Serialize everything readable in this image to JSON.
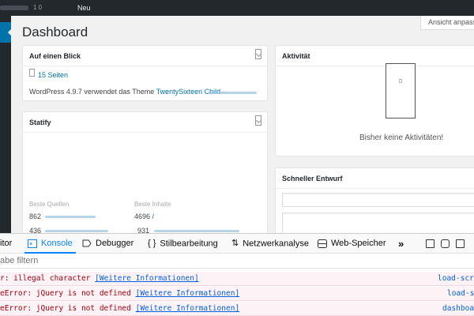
{
  "adminbar": {
    "counter": "1 0",
    "new_label": "Neu"
  },
  "header": {
    "title": "Dashboard",
    "screen_options": "Ansicht anpassen"
  },
  "at_a_glance": {
    "title": "Auf einen Blick",
    "pages": "15 Seiten",
    "wp_text": "WordPress 4.9.7 verwendet das Theme",
    "theme_link": "TwentySixteen Child"
  },
  "statify": {
    "title": "Statify",
    "col1_header": "Beste Quellen",
    "col2_header": "Beste Inhalte",
    "rows": [
      {
        "count1": "862",
        "count2": "4696",
        "path2": "/"
      },
      {
        "count1": "436",
        "count2": "931",
        "path2": ""
      }
    ]
  },
  "activity": {
    "title": "Aktivität",
    "empty": "Bisher keine Aktivitäten!"
  },
  "quick_draft": {
    "title": "Schneller Entwurf"
  },
  "devtools": {
    "tabs": [
      {
        "label": "itor"
      },
      {
        "label": "Konsole"
      },
      {
        "label": "Debugger"
      },
      {
        "label": "Stilbearbeitung"
      },
      {
        "label": "Netzwerkanalyse"
      },
      {
        "label": "Web-Speicher"
      },
      {
        "label": "»"
      }
    ],
    "filter_placeholder": "abe filtern",
    "logs": [
      {
        "message": "r: illegal character",
        "more": "[Weitere Informationen]",
        "source": "load-scr"
      },
      {
        "message": "eError: jQuery is not defined",
        "more": "[Weitere Informationen]",
        "source": "load-s"
      },
      {
        "message": "eError: jQuery is not defined",
        "more": "[Weitere Informationen]",
        "source": "dashboa"
      }
    ]
  },
  "colors": {
    "accent": "#0073aa",
    "adminbar": "#23282d",
    "devtools_active": "#0a84ff",
    "error_text": "#a4000f",
    "error_bg": "#fdf2f5"
  }
}
